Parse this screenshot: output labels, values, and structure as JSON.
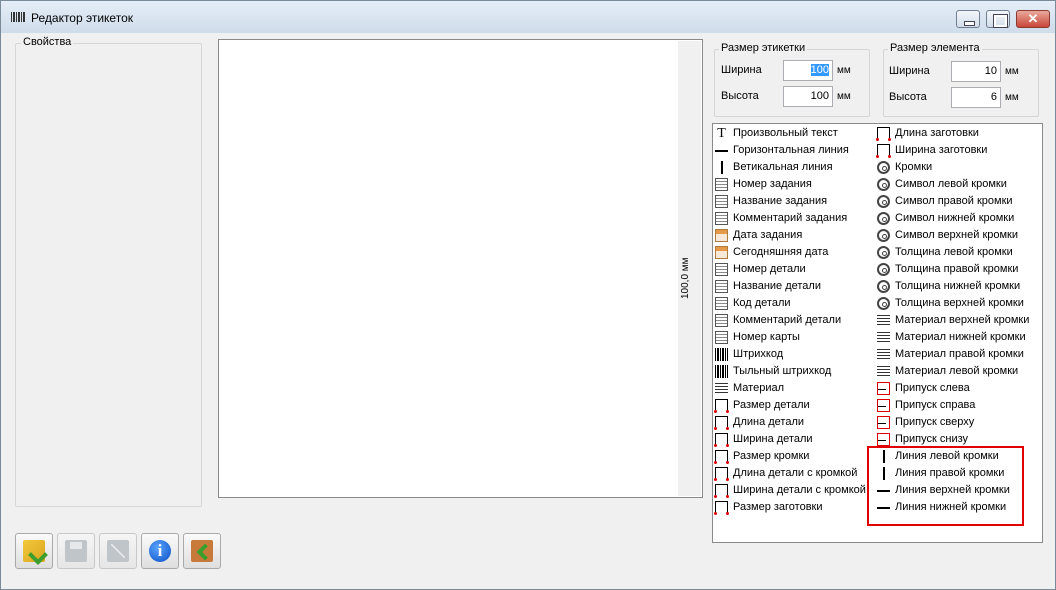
{
  "window": {
    "title": "Редактор этикеток",
    "close_glyph": "✕"
  },
  "properties": {
    "label": "Свойства"
  },
  "canvas": {
    "ruler_text": "100,0 мм"
  },
  "label_size": {
    "title": "Размер этикетки",
    "width_label": "Ширина",
    "width_value": "100",
    "width_unit": "мм",
    "height_label": "Высота",
    "height_value": "100",
    "height_unit": "мм"
  },
  "element_size": {
    "title": "Размер элемента",
    "width_label": "Ширина",
    "width_value": "10",
    "width_unit": "мм",
    "height_label": "Высота",
    "height_value": "6",
    "height_unit": "мм"
  },
  "palette": {
    "left": [
      {
        "label": "Произвольный текст",
        "icon": "text-icon"
      },
      {
        "label": "Горизонтальная линия",
        "icon": "horizontal-line-icon"
      },
      {
        "label": "Ветикальная линия",
        "icon": "vertical-line-icon"
      },
      {
        "label": "Номер задания",
        "icon": "document-icon"
      },
      {
        "label": "Название задания",
        "icon": "document-icon"
      },
      {
        "label": "Комментарий задания",
        "icon": "document-icon"
      },
      {
        "label": "Дата задания",
        "icon": "calendar-icon"
      },
      {
        "label": "Сегодняшняя дата",
        "icon": "calendar-icon"
      },
      {
        "label": "Номер детали",
        "icon": "document-icon"
      },
      {
        "label": "Название детали",
        "icon": "document-icon"
      },
      {
        "label": "Код детали",
        "icon": "document-icon"
      },
      {
        "label": "Комментарий детали",
        "icon": "document-icon"
      },
      {
        "label": "Номер карты",
        "icon": "document-icon"
      },
      {
        "label": "Штрихкод",
        "icon": "barcode-icon"
      },
      {
        "label": "Тыльный штрихкод",
        "icon": "barcode-icon"
      },
      {
        "label": "Материал",
        "icon": "material-icon"
      },
      {
        "label": "Размер детали",
        "icon": "dimension-icon"
      },
      {
        "label": "Длина детали",
        "icon": "dimension-icon"
      },
      {
        "label": "Ширина детали",
        "icon": "dimension-icon"
      },
      {
        "label": "Размер кромки",
        "icon": "dimension-icon"
      },
      {
        "label": "Длина детали с кромкой",
        "icon": "dimension-icon"
      },
      {
        "label": "Ширина детали с кромкой",
        "icon": "dimension-icon"
      },
      {
        "label": "Размер заготовки",
        "icon": "dimension-icon"
      }
    ],
    "right": [
      {
        "label": "Длина заготовки",
        "icon": "dimension-icon"
      },
      {
        "label": "Ширина заготовки",
        "icon": "dimension-icon"
      },
      {
        "label": "Кромки",
        "icon": "spiral-icon"
      },
      {
        "label": "Символ левой кромки",
        "icon": "spiral-icon"
      },
      {
        "label": "Символ правой кромки",
        "icon": "spiral-icon"
      },
      {
        "label": "Символ нижней кромки",
        "icon": "spiral-icon"
      },
      {
        "label": "Символ верхней кромки",
        "icon": "spiral-icon"
      },
      {
        "label": "Толщина левой кромки",
        "icon": "spiral-icon"
      },
      {
        "label": "Толщина правой кромки",
        "icon": "spiral-icon"
      },
      {
        "label": "Толщина нижней кромки",
        "icon": "spiral-icon"
      },
      {
        "label": "Толщина верхней кромки",
        "icon": "spiral-icon"
      },
      {
        "label": "Материал верхней кромки",
        "icon": "material-icon"
      },
      {
        "label": "Материал нижней кромки",
        "icon": "material-icon"
      },
      {
        "label": "Материал правой кромки",
        "icon": "material-icon"
      },
      {
        "label": "Материал левой кромки",
        "icon": "material-icon"
      },
      {
        "label": "Припуск слева",
        "icon": "allowance-icon"
      },
      {
        "label": "Припуск справа",
        "icon": "allowance-icon"
      },
      {
        "label": "Припуск сверху",
        "icon": "allowance-icon"
      },
      {
        "label": "Припуск снизу",
        "icon": "allowance-icon"
      },
      {
        "label": "Линия левой кромки",
        "icon": "vertical-line-icon"
      },
      {
        "label": "Линия правой кромки",
        "icon": "vertical-line-icon"
      },
      {
        "label": "Линия верхней кромки",
        "icon": "horizontal-line-icon"
      },
      {
        "label": "Линия нижней кромки",
        "icon": "horizontal-line-icon"
      }
    ]
  },
  "toolbar": {
    "buttons": [
      {
        "name": "open-button",
        "icon": "open-folder-icon",
        "enabled": true
      },
      {
        "name": "save-button",
        "icon": "floppy-disk-icon",
        "enabled": false
      },
      {
        "name": "save-as-button",
        "icon": "floppy-disk-edit-icon",
        "enabled": false
      },
      {
        "name": "info-button",
        "icon": "info-icon",
        "enabled": true,
        "glyph": "i"
      },
      {
        "name": "exit-button",
        "icon": "exit-door-icon",
        "enabled": true
      }
    ]
  }
}
